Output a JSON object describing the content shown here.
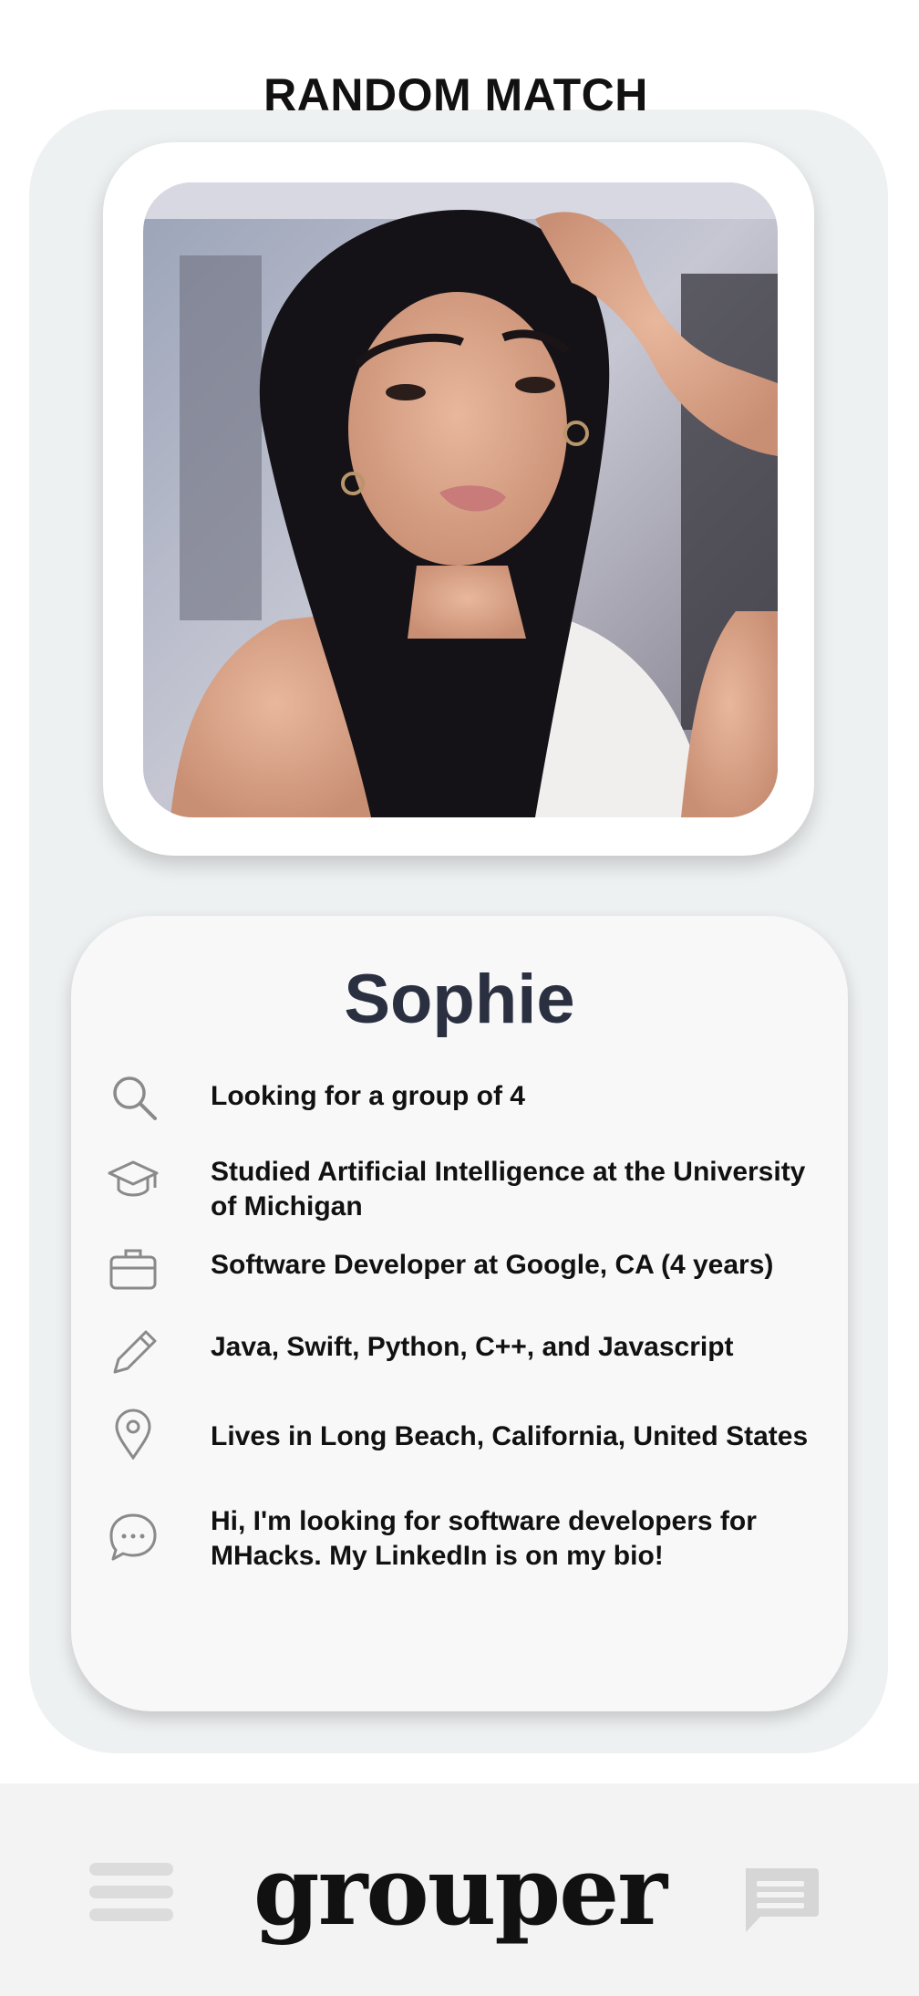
{
  "header": {
    "title": "RANDOM MATCH"
  },
  "profile": {
    "name": "Sophie",
    "details": [
      {
        "icon": "search-icon",
        "text": "Looking for a group of 4"
      },
      {
        "icon": "graduation-cap-icon",
        "text": "Studied Artificial Intelligence at the University of Michigan"
      },
      {
        "icon": "briefcase-icon",
        "text": "Software Developer at Google, CA (4 years)"
      },
      {
        "icon": "pencil-icon",
        "text": "Java, Swift, Python, C++, and Javascript"
      },
      {
        "icon": "location-pin-icon",
        "text": "Lives in Long Beach, California, United States"
      },
      {
        "icon": "chat-bubble-icon",
        "text": "Hi, I'm looking for software developers for MHacks. My LinkedIn is on my bio!"
      }
    ]
  },
  "bottom_bar": {
    "logo": "grouper",
    "left_icon": "hamburger-menu-icon",
    "right_icon": "chat-icon"
  },
  "colors": {
    "panel": "#eef1f2",
    "card": "#f8f8f9",
    "name": "#2b3040",
    "icon_gray": "#8a8a8a",
    "bar": "#f3f3f3"
  }
}
